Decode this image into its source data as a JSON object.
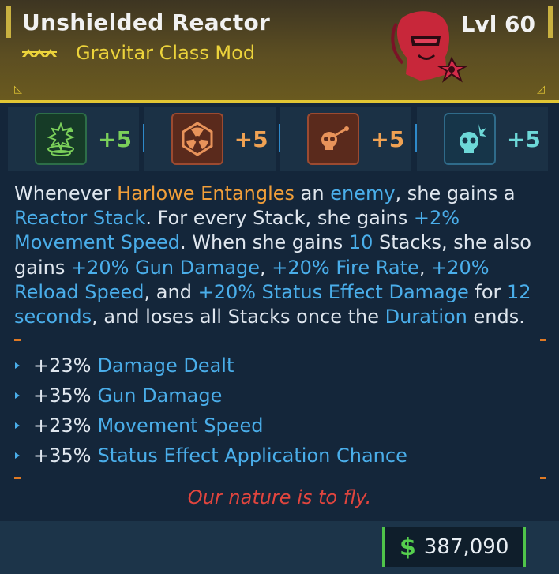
{
  "header": {
    "title": "Unshielded Reactor",
    "level": "Lvl 60",
    "item_type": "Gravitar Class Mod",
    "rarity_icon": "rarity-chevrons-icon",
    "portrait_icon": "character-portrait-icon"
  },
  "skills": [
    {
      "icon": "entangle-skill-icon",
      "bonus": "+5",
      "color": "#7bd05a"
    },
    {
      "icon": "radiation-skill-icon",
      "bonus": "+5",
      "color": "#f0a253"
    },
    {
      "icon": "skull-rocket-skill-icon",
      "bonus": "+5",
      "color": "#f0a253"
    },
    {
      "icon": "skull-burst-skill-icon",
      "bonus": "+5",
      "color": "#6dd8d8"
    }
  ],
  "description": {
    "p01": "Whenever ",
    "p02": "Harlowe Entangles",
    "p03": " an ",
    "p04": "enemy",
    "p05": ", she gains a ",
    "p06": "Reactor Stack",
    "p07": ". For every Stack, she gains ",
    "p08": "+2% Movement Speed",
    "p09": ". When she gains ",
    "p10": "10",
    "p11": " Stacks, she also gains ",
    "p12": "+20% Gun Damage",
    "p13": ", ",
    "p14": "+20% Fire Rate",
    "p15": ", ",
    "p16": "+20% Reload Speed",
    "p17": ", and ",
    "p18": "+20% Status Effect Damage",
    "p19": " for ",
    "p20": "12 seconds",
    "p21": ", and loses all Stacks once the ",
    "p22": "Duration",
    "p23": " ends."
  },
  "stats": [
    {
      "value": "+23%",
      "name": "Damage Dealt"
    },
    {
      "value": "+35%",
      "name": "Gun Damage"
    },
    {
      "value": "+23%",
      "name": "Movement Speed"
    },
    {
      "value": "+35%",
      "name": "Status Effect Application Chance"
    }
  ],
  "flavor": "Our nature is to fly.",
  "price": {
    "icon": "dollar-icon",
    "symbol": "$",
    "value": "387,090"
  },
  "colors": {
    "accent_yellow": "#e2c634",
    "keyword_orange": "#f29f39",
    "keyword_blue": "#4aaeea",
    "flavor_red": "#e2453e",
    "money_green": "#4fc44a"
  }
}
